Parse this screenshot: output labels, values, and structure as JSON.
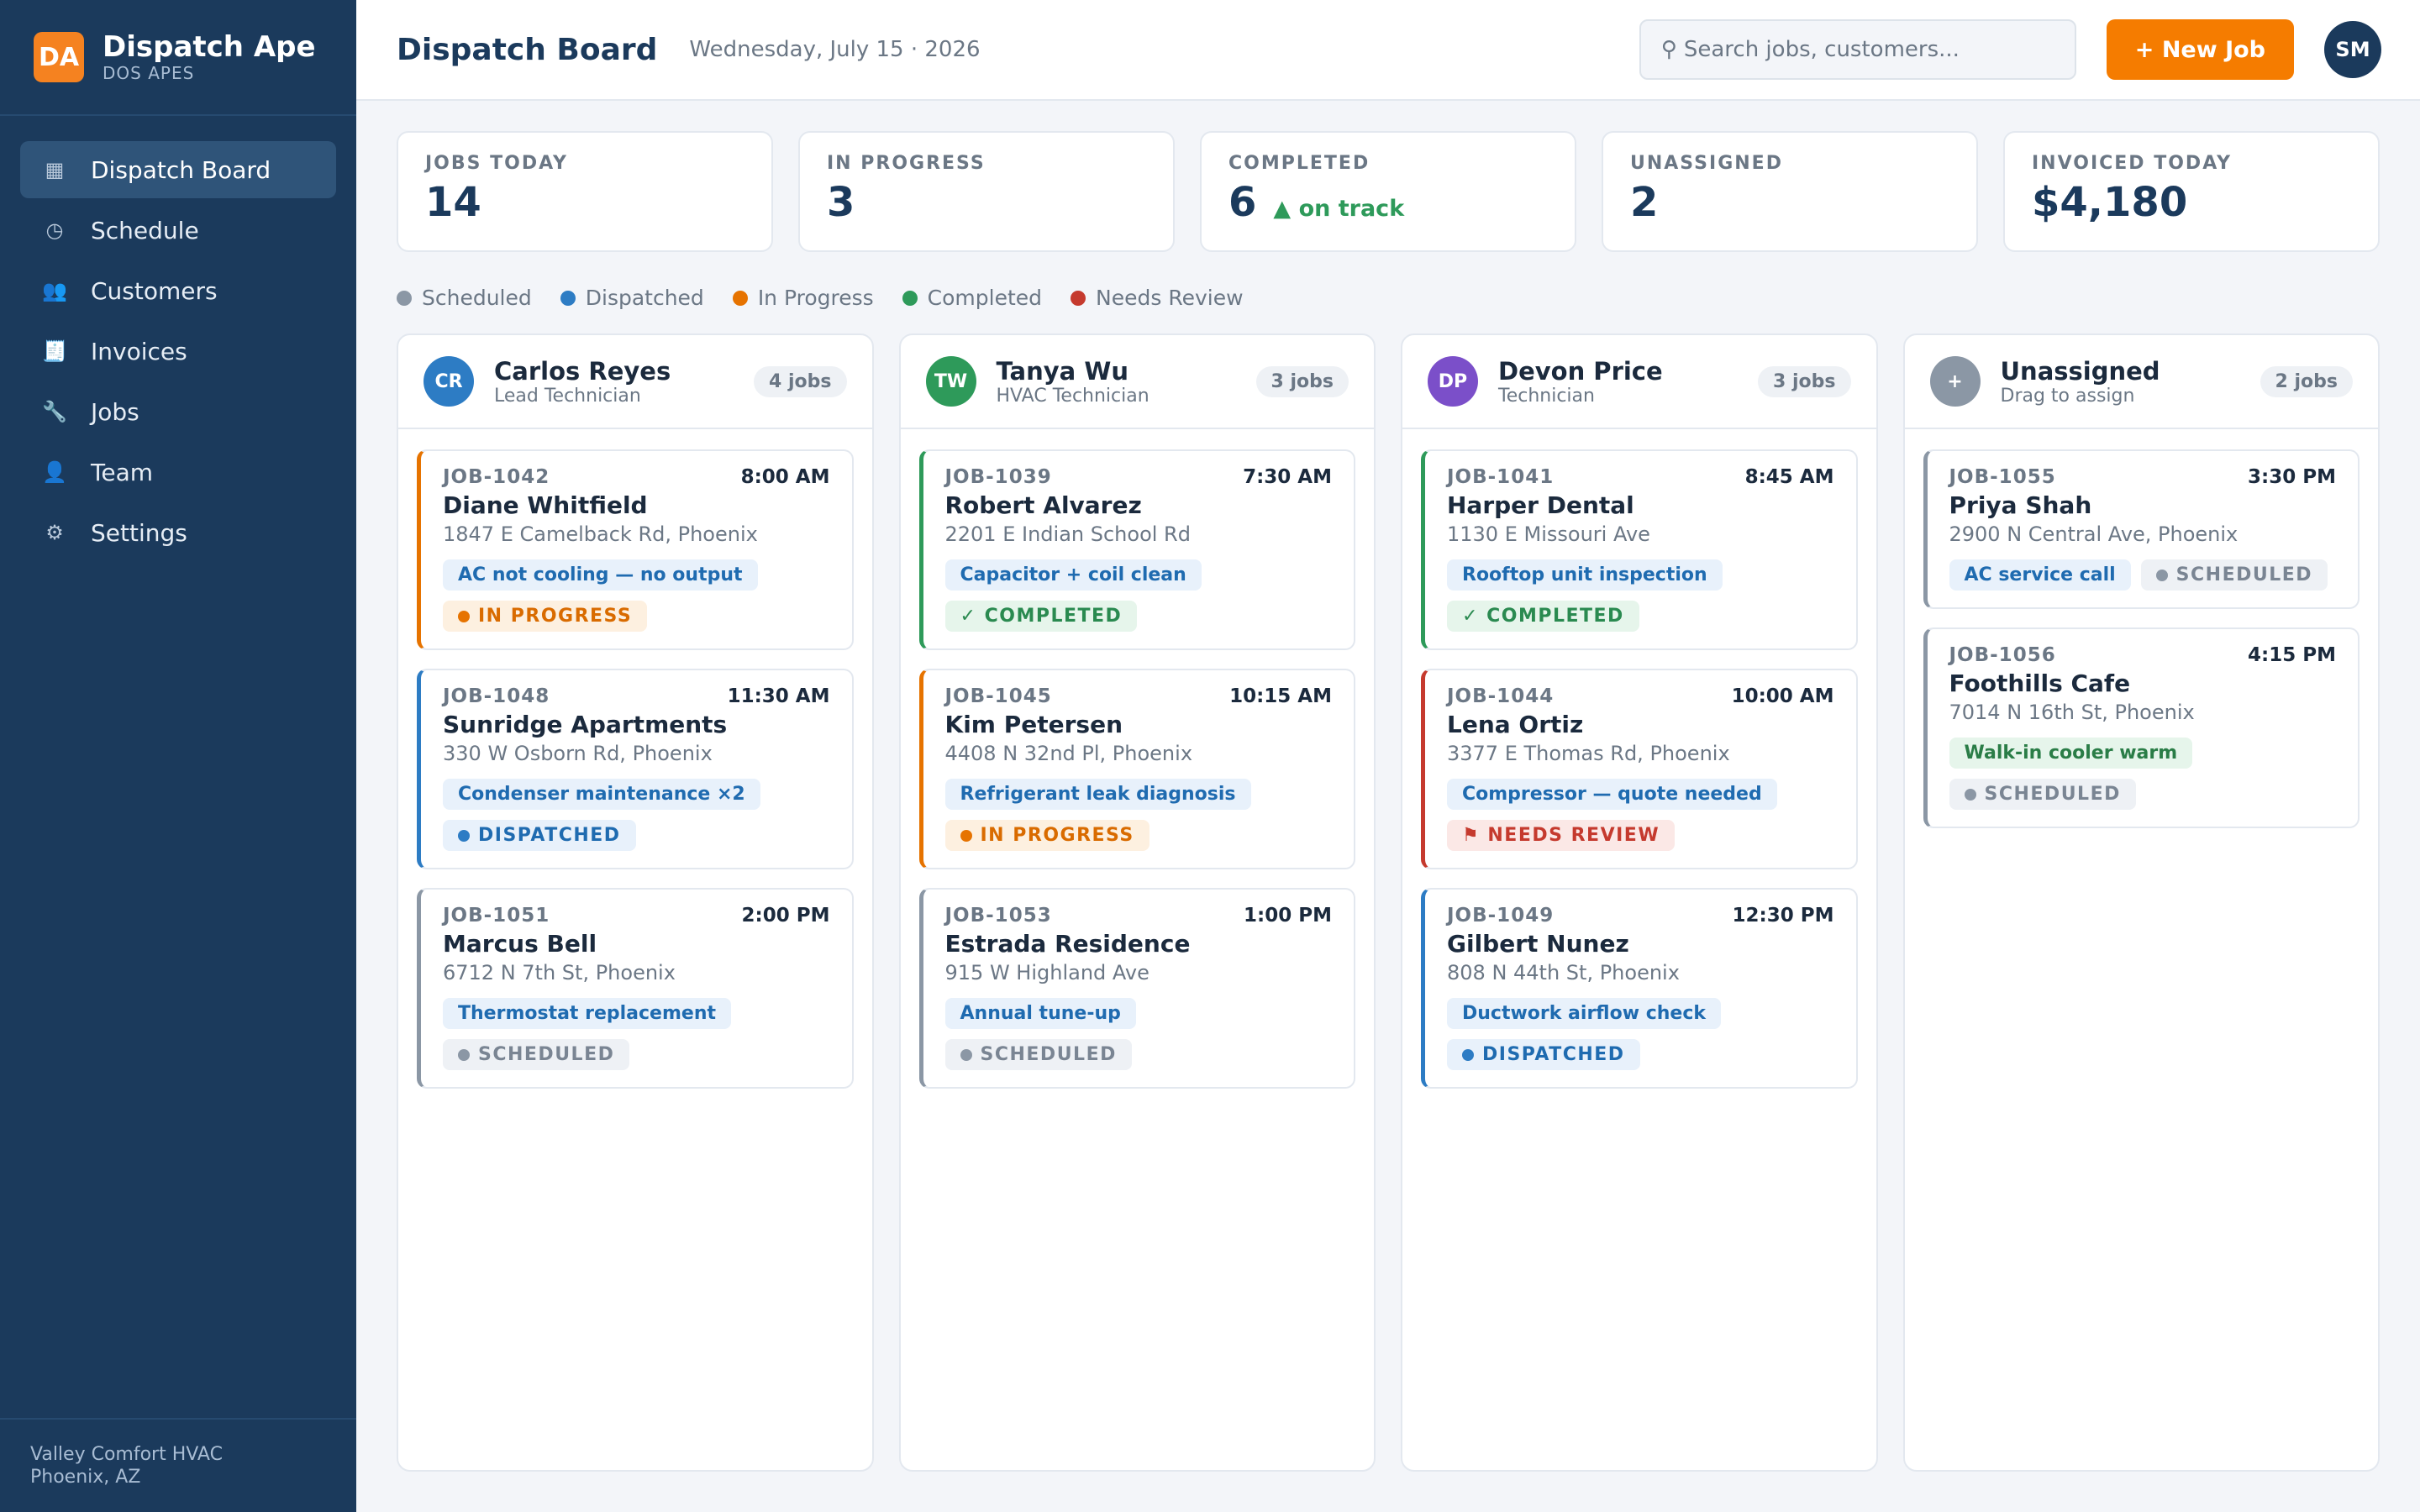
{
  "brand": {
    "logo": "DA",
    "name": "Dispatch Ape",
    "sub": "DOS APES"
  },
  "nav": [
    {
      "label": "Dispatch Board",
      "icon": "▦",
      "active": true,
      "name": "dispatch-board"
    },
    {
      "label": "Schedule",
      "icon": "◷",
      "active": false,
      "name": "schedule"
    },
    {
      "label": "Customers",
      "icon": "👥",
      "active": false,
      "name": "customers"
    },
    {
      "label": "Invoices",
      "icon": "🧾",
      "active": false,
      "name": "invoices"
    },
    {
      "label": "Jobs",
      "icon": "🔧",
      "active": false,
      "name": "jobs"
    },
    {
      "label": "Team",
      "icon": "👤",
      "active": false,
      "name": "team"
    },
    {
      "label": "Settings",
      "icon": "⚙",
      "active": false,
      "name": "settings"
    }
  ],
  "footer": {
    "company": "Valley Comfort HVAC",
    "location": "Phoenix, AZ"
  },
  "header": {
    "title": "Dispatch Board",
    "date": "Wednesday, July 15 · 2026",
    "search_placeholder": "Search jobs, customers...",
    "new_job": "+ New Job",
    "user_initials": "SM"
  },
  "stats": [
    {
      "label": "JOBS TODAY",
      "value": "14",
      "note": ""
    },
    {
      "label": "IN PROGRESS",
      "value": "3",
      "note": ""
    },
    {
      "label": "COMPLETED",
      "value": "6",
      "note": "▲ on track"
    },
    {
      "label": "UNASSIGNED",
      "value": "2",
      "note": ""
    },
    {
      "label": "INVOICED TODAY",
      "value": "$4,180",
      "note": ""
    }
  ],
  "legend": [
    {
      "label": "Scheduled",
      "color": "#8b97a5"
    },
    {
      "label": "Dispatched",
      "color": "#2d7cc4"
    },
    {
      "label": "In Progress",
      "color": "#e67300"
    },
    {
      "label": "Completed",
      "color": "#2e9a5a"
    },
    {
      "label": "Needs Review",
      "color": "#c53a2e"
    }
  ],
  "columns": [
    {
      "initials": "CR",
      "avatar_color": "#2d7cc4",
      "name": "Carlos Reyes",
      "role": "Lead Technician",
      "count": "4 jobs",
      "jobs": [
        {
          "id": "JOB-1042",
          "time": "8:00 AM",
          "customer": "Diane Whitfield",
          "address": "1847 E Camelback Rd, Phoenix",
          "desc": "AC not cooling — no output",
          "desc_green": false,
          "status": "progress",
          "status_label": "IN PROGRESS",
          "border": "#e67300"
        },
        {
          "id": "JOB-1048",
          "time": "11:30 AM",
          "customer": "Sunridge Apartments",
          "address": "330 W Osborn Rd, Phoenix",
          "desc": "Condenser maintenance ×2",
          "desc_green": false,
          "status": "dispatched",
          "status_label": "DISPATCHED",
          "border": "#2d7cc4"
        },
        {
          "id": "JOB-1051",
          "time": "2:00 PM",
          "customer": "Marcus Bell",
          "address": "6712 N 7th St, Phoenix",
          "desc": "Thermostat replacement",
          "desc_green": false,
          "status": "scheduled",
          "status_label": "SCHEDULED",
          "border": "#8b97a5"
        }
      ]
    },
    {
      "initials": "TW",
      "avatar_color": "#2e9a5a",
      "name": "Tanya Wu",
      "role": "HVAC Technician",
      "count": "3 jobs",
      "jobs": [
        {
          "id": "JOB-1039",
          "time": "7:30 AM",
          "customer": "Robert Alvarez",
          "address": "2201 E Indian School Rd",
          "desc": "Capacitor + coil clean",
          "desc_green": false,
          "status": "completed",
          "status_label": "✓ COMPLETED",
          "border": "#2e9a5a"
        },
        {
          "id": "JOB-1045",
          "time": "10:15 AM",
          "customer": "Kim Petersen",
          "address": "4408 N 32nd Pl, Phoenix",
          "desc": "Refrigerant leak diagnosis",
          "desc_green": false,
          "status": "progress",
          "status_label": "IN PROGRESS",
          "border": "#e67300"
        },
        {
          "id": "JOB-1053",
          "time": "1:00 PM",
          "customer": "Estrada Residence",
          "address": "915 W Highland Ave",
          "desc": "Annual tune-up",
          "desc_green": false,
          "status": "scheduled",
          "status_label": "SCHEDULED",
          "border": "#8b97a5"
        }
      ]
    },
    {
      "initials": "DP",
      "avatar_color": "#7b4fc9",
      "name": "Devon Price",
      "role": "Technician",
      "count": "3 jobs",
      "jobs": [
        {
          "id": "JOB-1041",
          "time": "8:45 AM",
          "customer": "Harper Dental",
          "address": "1130 E Missouri Ave",
          "desc": "Rooftop unit inspection",
          "desc_green": false,
          "status": "completed",
          "status_label": "✓ COMPLETED",
          "border": "#2e9a5a"
        },
        {
          "id": "JOB-1044",
          "time": "10:00 AM",
          "customer": "Lena Ortiz",
          "address": "3377 E Thomas Rd, Phoenix",
          "desc": "Compressor — quote needed",
          "desc_green": false,
          "status": "review",
          "status_label": "⚑ NEEDS REVIEW",
          "border": "#c53a2e"
        },
        {
          "id": "JOB-1049",
          "time": "12:30 PM",
          "customer": "Gilbert Nunez",
          "address": "808 N 44th St, Phoenix",
          "desc": "Ductwork airflow check",
          "desc_green": false,
          "status": "dispatched",
          "status_label": "DISPATCHED",
          "border": "#2d7cc4"
        }
      ]
    },
    {
      "initials": "+",
      "avatar_color": "#8b97a5",
      "name": "Unassigned",
      "role": "Drag to assign",
      "count": "2 jobs",
      "jobs": [
        {
          "id": "JOB-1055",
          "time": "3:30 PM",
          "customer": "Priya Shah",
          "address": "2900 N Central Ave, Phoenix",
          "desc": "AC service call",
          "desc_green": false,
          "status": "scheduled",
          "status_label": "SCHEDULED",
          "border": "#8b97a5"
        },
        {
          "id": "JOB-1056",
          "time": "4:15 PM",
          "customer": "Foothills Cafe",
          "address": "7014 N 16th St, Phoenix",
          "desc": "Walk-in cooler warm",
          "desc_green": true,
          "status": "scheduled",
          "status_label": "SCHEDULED",
          "border": "#8b97a5"
        }
      ]
    }
  ]
}
